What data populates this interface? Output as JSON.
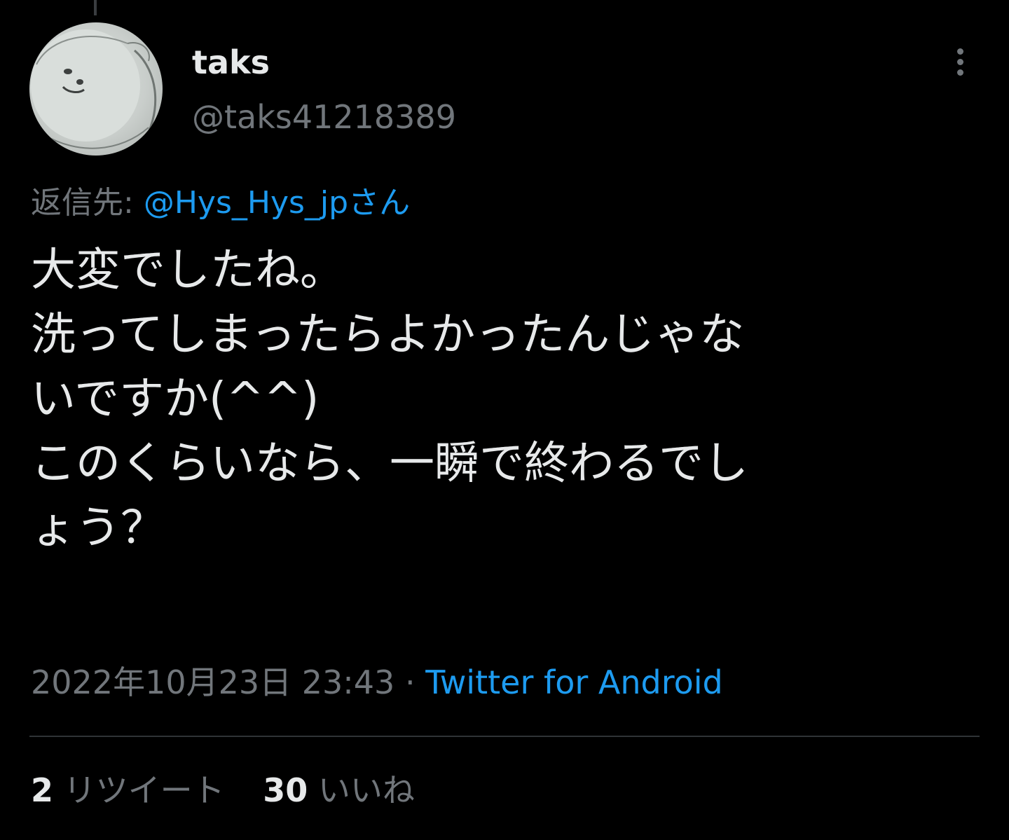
{
  "user": {
    "display_name": "taks",
    "handle": "@taks41218389"
  },
  "reply": {
    "prefix": "返信先: ",
    "mention": "@Hys_Hys_jpさん"
  },
  "tweet": {
    "lines": [
      "大変でしたね。",
      "洗ってしまったらよかったんじゃな",
      "いですか(^^)",
      "このくらいなら、一瞬で終わるでし",
      "ょう？"
    ]
  },
  "meta": {
    "timestamp": "2022年10月23日 23:43",
    "separator": " · ",
    "source": "Twitter for Android"
  },
  "stats": {
    "retweets_count": "2",
    "retweets_label": "リツイート",
    "likes_count": "30",
    "likes_label": "いいね"
  },
  "icons": {
    "more": "more-vertical-icon"
  },
  "colors": {
    "background": "#000000",
    "text_primary": "#e7e9ea",
    "text_secondary": "#71767b",
    "link": "#1d9bf0",
    "divider": "#2f3336"
  }
}
